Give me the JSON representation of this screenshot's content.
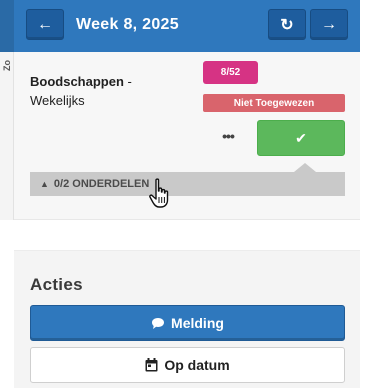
{
  "header": {
    "prev_icon": "arrow-left-icon",
    "prev_glyph": "←",
    "title": "Week 8, 2025",
    "refresh_icon": "refresh-icon",
    "refresh_glyph": "↻",
    "next_icon": "arrow-right-icon",
    "next_glyph": "→",
    "color": "#2f78bd"
  },
  "sidebar": {
    "label": "Zo"
  },
  "task": {
    "name": "Boodschappen",
    "separator": " - ",
    "frequency": "Wekelijks",
    "count_badge": "8/52",
    "count_color": "#d63384",
    "status_badge": "Niet Toegewezen",
    "status_color": "#d9646c",
    "more_glyph": "•••",
    "complete_icon": "check-icon",
    "complete_glyph": "✔",
    "complete_color": "#5cb85c",
    "parts_chevron": "▲",
    "parts_label": "0/2 ONDERDELEN"
  },
  "actions": {
    "title": "Acties",
    "melding_icon": "comment-icon",
    "melding_glyph": "💬",
    "melding_label": "Melding",
    "datum_icon": "calendar-icon",
    "datum_glyph": "📅",
    "datum_label": "Op datum"
  }
}
